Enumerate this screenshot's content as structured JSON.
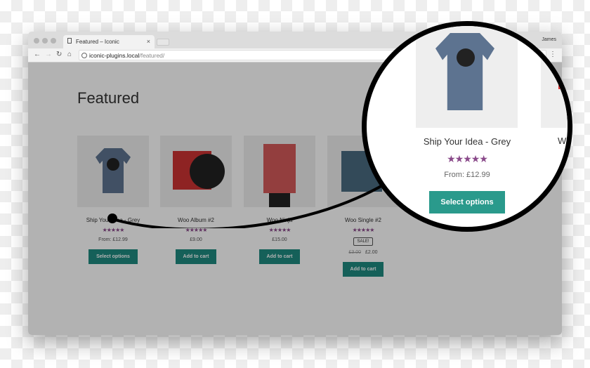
{
  "browser": {
    "tab_title": "Featured – Iconic",
    "user": "James",
    "url_host": "iconic-plugins.local",
    "url_path": "/featured/"
  },
  "page": {
    "title": "Featured"
  },
  "products": [
    {
      "name": "Ship Your Idea - Grey",
      "rating": 4.5,
      "stars": "★★★★★",
      "price": "From: £12.99",
      "button": "Select options"
    },
    {
      "name": "Woo Album #2",
      "rating": 4,
      "stars": "★★★★★",
      "price": "£9.00",
      "button": "Add to cart"
    },
    {
      "name": "Woo Ninja",
      "rating": 4,
      "stars": "★★★★★",
      "price": "£15.00",
      "button": "Add to cart"
    },
    {
      "name": "Woo Single #2",
      "rating": 4.5,
      "stars": "★★★★★",
      "badge": "SALE!",
      "old_price": "£3.00",
      "price": "£2.00",
      "button": "Add to cart"
    }
  ],
  "magnifier": {
    "name": "Ship Your Idea - Grey",
    "stars": "★★★★★",
    "price": "From: £12.99",
    "button": "Select options",
    "next_partial": "Wo"
  },
  "colors": {
    "button": "#1f8a80",
    "stars": "#8a4a8a"
  }
}
